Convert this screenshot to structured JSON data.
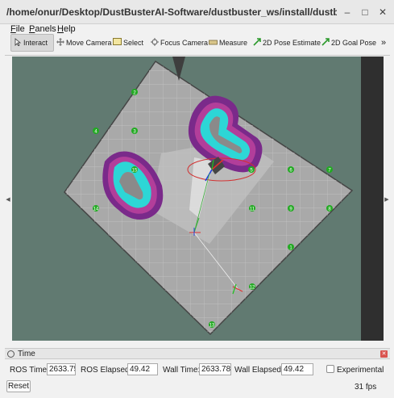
{
  "window": {
    "title": "/home/onur/Desktop/DustBusterAI-Software/dustbuster_ws/install/dustbuster_launch/shar...",
    "minimize": "–",
    "maximize": "□",
    "close": "✕"
  },
  "menu": [
    "File",
    "Panels",
    "Help"
  ],
  "toolbar": {
    "tools": [
      {
        "label": "Interact",
        "icon": "interact-icon",
        "active": true
      },
      {
        "label": "Move Camera",
        "icon": "move-camera-icon"
      },
      {
        "label": "Select",
        "icon": "select-icon"
      },
      {
        "label": "Focus Camera",
        "icon": "focus-camera-icon"
      },
      {
        "label": "Measure",
        "icon": "measure-icon"
      },
      {
        "label": "2D Pose Estimate",
        "icon": "pose-estimate-icon"
      },
      {
        "label": "2D Goal Pose",
        "icon": "goal-pose-icon"
      }
    ],
    "overflow": "»"
  },
  "viewport": {
    "left_handle": "◀",
    "right_handle": "▶",
    "marker_labels": [
      "2",
      "4",
      "3",
      "15",
      "6",
      "7",
      "14",
      "11",
      "9",
      "8",
      "1",
      "12",
      "13",
      "5"
    ]
  },
  "time_panel": {
    "title": "Time",
    "close": "✕",
    "ros_time_label": "ROS Time:",
    "ros_time_value": "2633.75",
    "ros_elapsed_label": "ROS Elapsed:",
    "ros_elapsed_value": "49.42",
    "wall_time_label": "Wall Time:",
    "wall_time_value": "2633.78",
    "wall_elapsed_label": "Wall Elapsed:",
    "wall_elapsed_value": "49.42",
    "experimental_label": "Experimental",
    "experimental_checked": false
  },
  "footer": {
    "reset_label": "Reset",
    "fps": "31 fps"
  }
}
